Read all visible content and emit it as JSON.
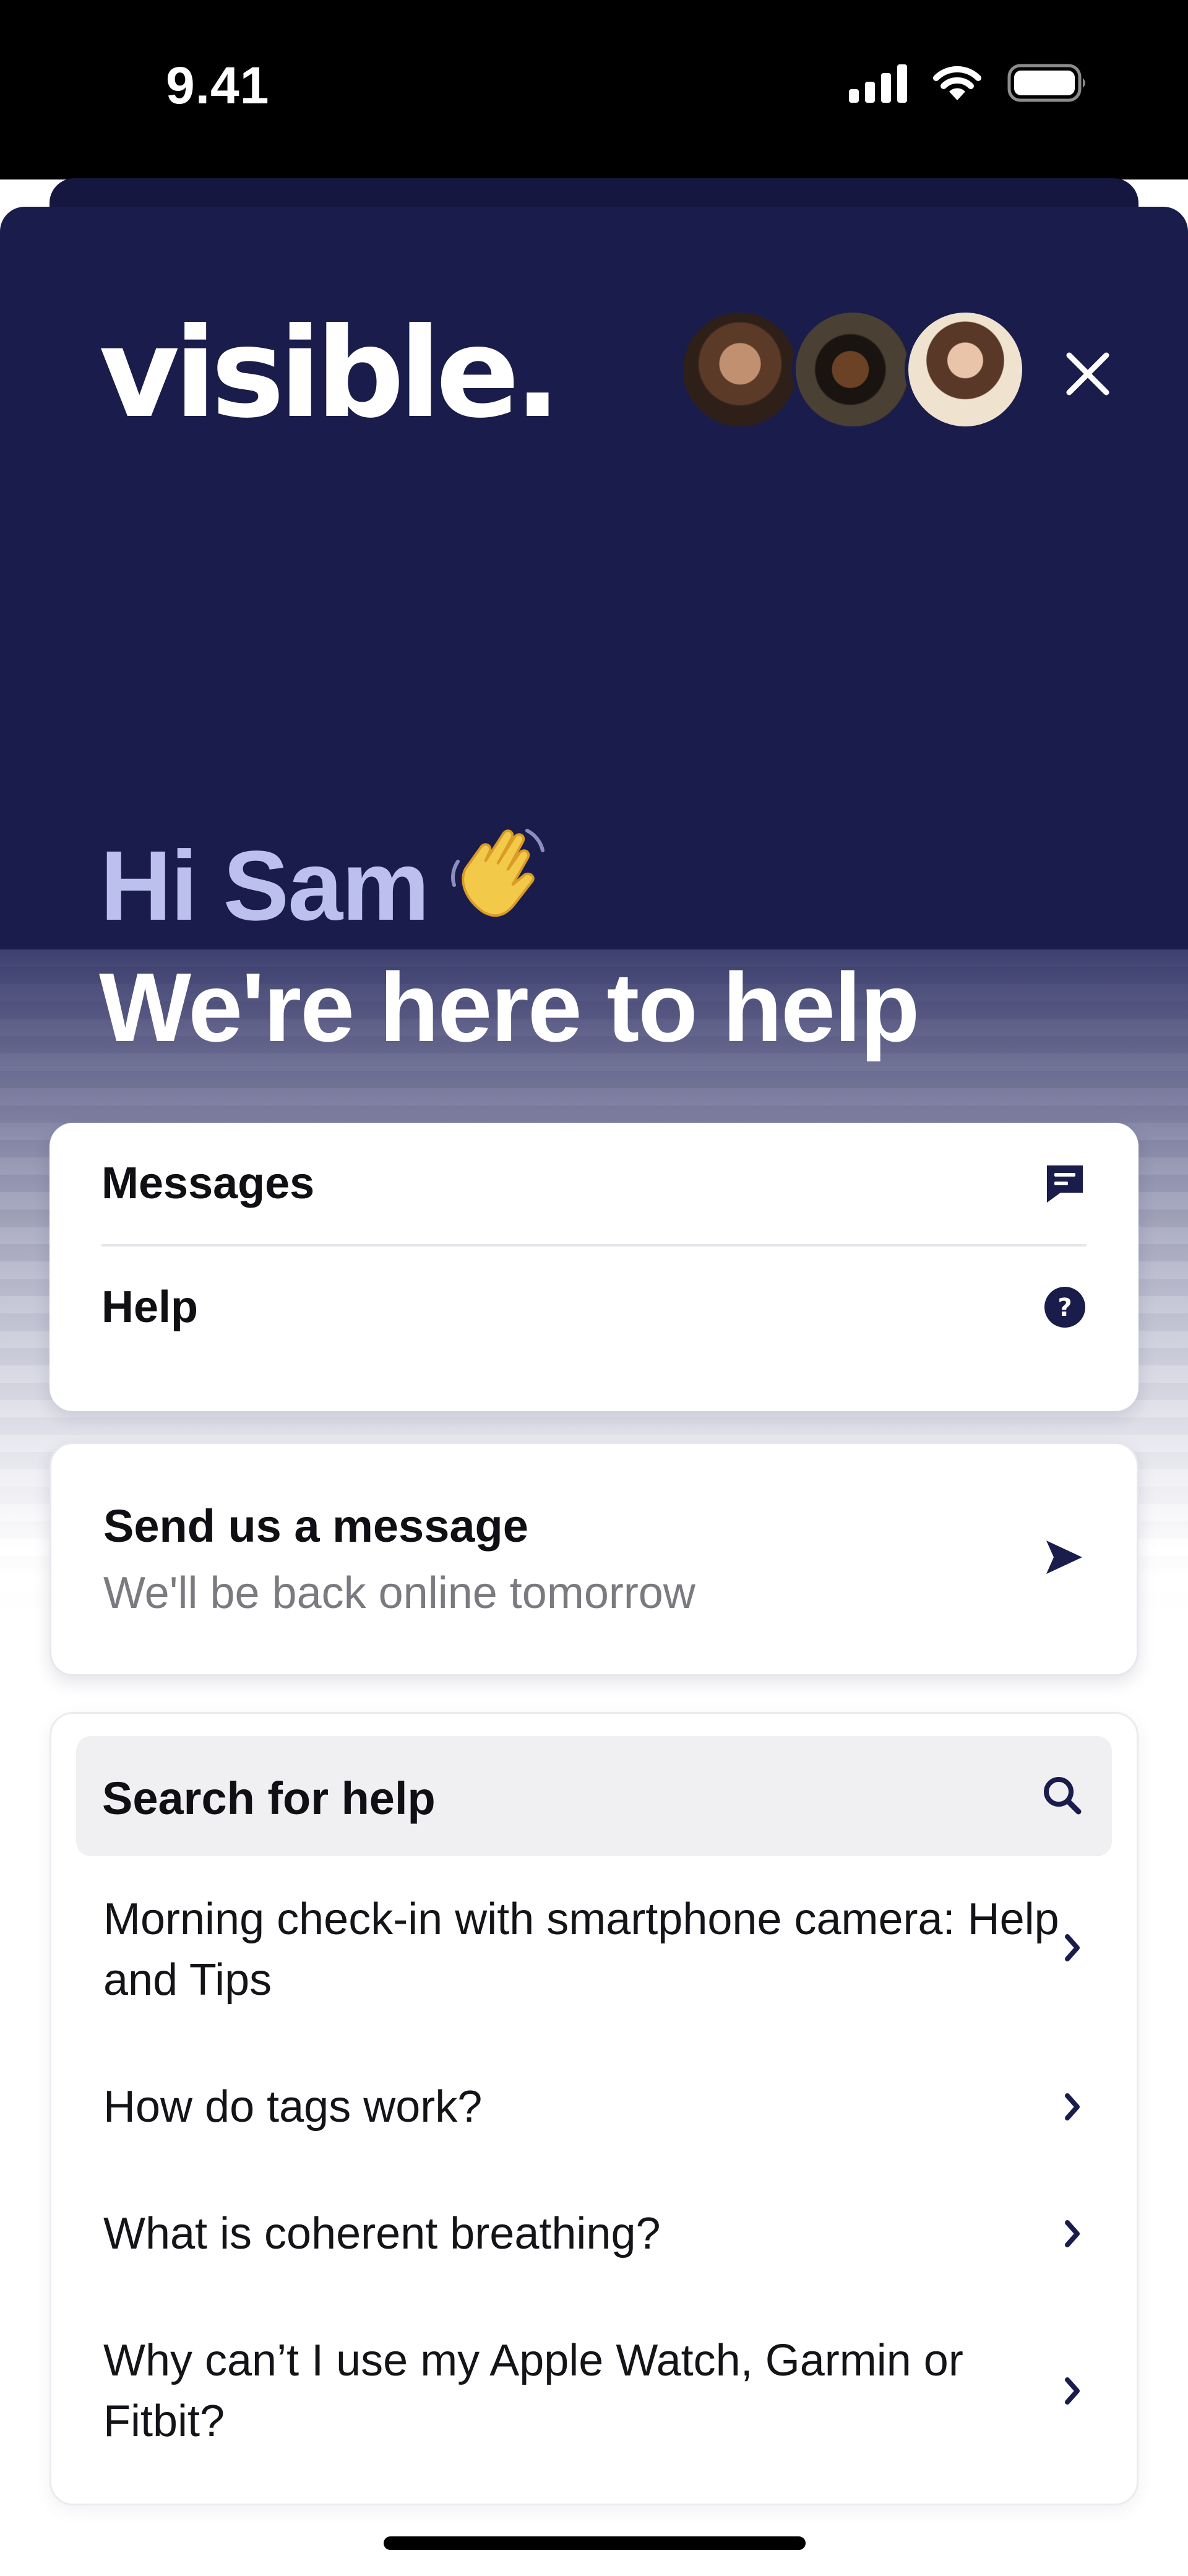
{
  "status_bar": {
    "time": "9.41",
    "icons": [
      "cellular-signal-icon",
      "wifi-icon",
      "battery-icon"
    ]
  },
  "header": {
    "logo_text": "visible.",
    "avatars": [
      "support-agent-1",
      "support-agent-2",
      "support-agent-3"
    ],
    "close_icon": "close-icon"
  },
  "hero": {
    "greeting": "Hi Sam",
    "greeting_emoji_icon": "waving-hand-icon",
    "headline": "We're here to help"
  },
  "nav_card": {
    "items": [
      {
        "label": "Messages",
        "icon": "messages-icon"
      },
      {
        "label": "Help",
        "icon": "help-circle-icon"
      }
    ]
  },
  "send_card": {
    "title": "Send us a message",
    "subtitle": "We'll be back online tomorrow",
    "icon": "send-icon"
  },
  "search_card": {
    "search_label": "Search for help",
    "search_icon": "search-icon",
    "articles": [
      {
        "title": "Morning check-in with smartphone camera: Help and Tips"
      },
      {
        "title": "How do tags work?"
      },
      {
        "title": "What is coherent breathing?"
      },
      {
        "title": "Why can’t I use my Apple Watch, Garmin or Fitbit?"
      }
    ]
  },
  "colors": {
    "hero_background": "#1a1c4b",
    "greeting_text": "#bcc0ec",
    "accent_icons": "#1a1c4b"
  }
}
